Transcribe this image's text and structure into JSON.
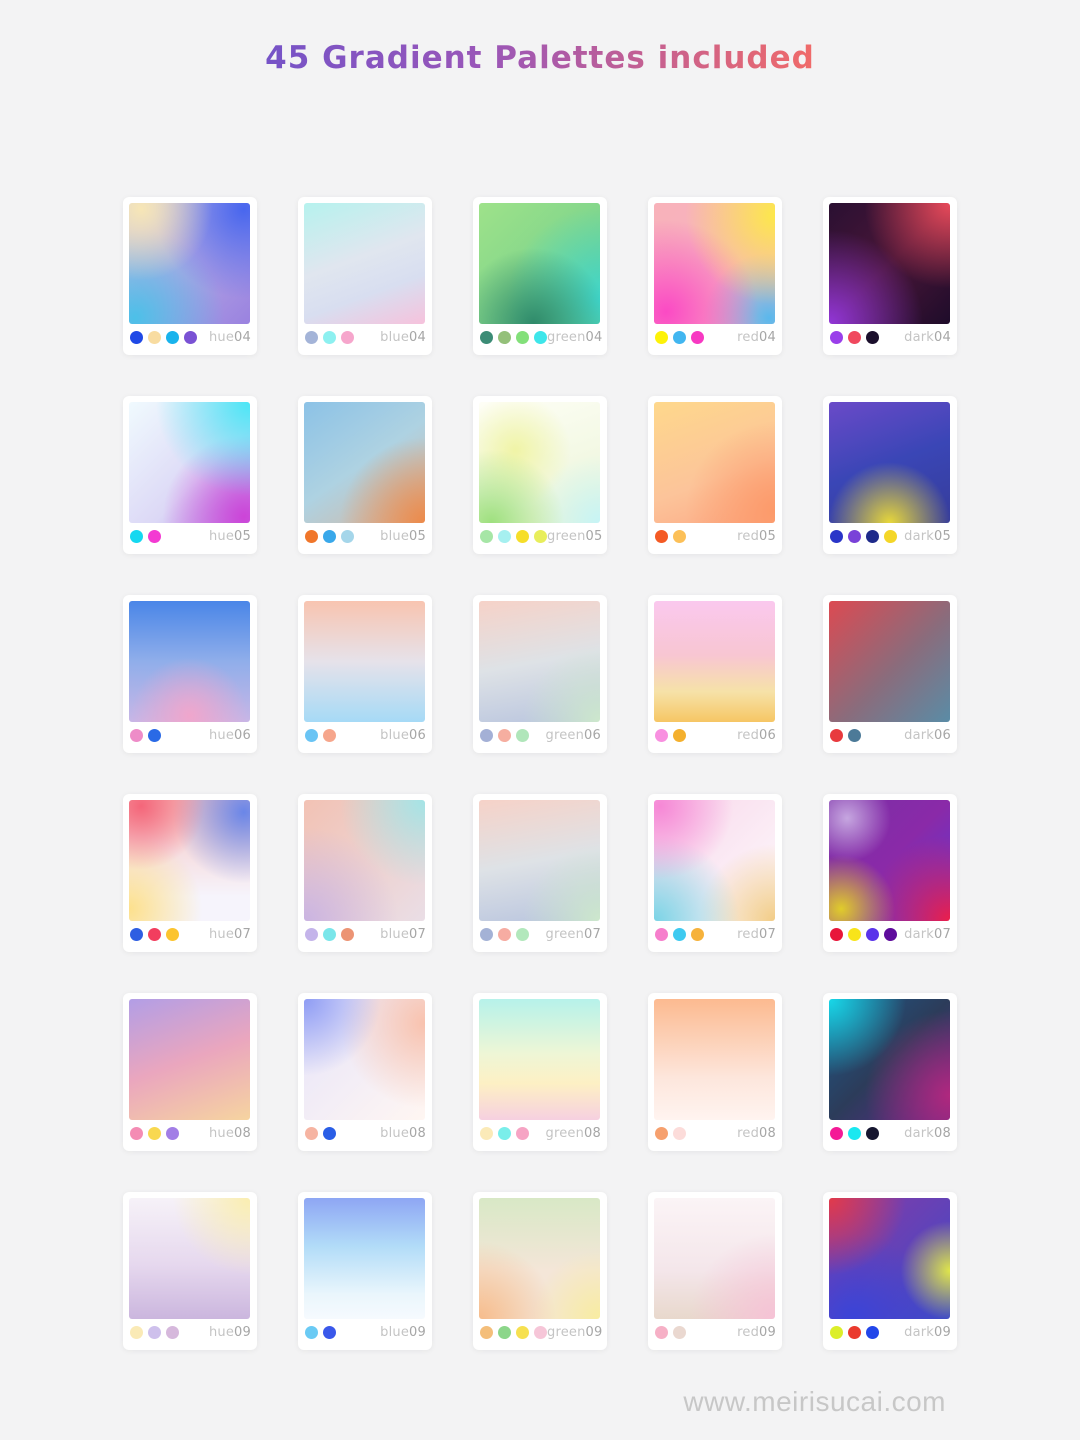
{
  "title": "45 Gradient Palettes included",
  "watermark": "www.meirisucai.com",
  "palettes": [
    {
      "name": "hue",
      "num": "04",
      "colors": [
        "#1f49e6",
        "#f8dca1",
        "#19b3ec",
        "#7a52d4"
      ]
    },
    {
      "name": "blue",
      "num": "04",
      "colors": [
        "#a4b4d8",
        "#8df0f0",
        "#f6a6cc"
      ]
    },
    {
      "name": "green",
      "num": "04",
      "colors": [
        "#3c8c76",
        "#94c07a",
        "#83e07a",
        "#3ee6ea"
      ]
    },
    {
      "name": "red",
      "num": "04",
      "colors": [
        "#fdf208",
        "#42b6f0",
        "#f739c2"
      ]
    },
    {
      "name": "dark",
      "num": "04",
      "colors": [
        "#9a3fea",
        "#f0485e",
        "#1b0f2c"
      ]
    },
    {
      "name": "hue",
      "num": "05",
      "colors": [
        "#15d8f0",
        "#f33ad2"
      ]
    },
    {
      "name": "blue",
      "num": "05",
      "colors": [
        "#f0762a",
        "#39a8ea",
        "#a5d6ea"
      ]
    },
    {
      "name": "green",
      "num": "05",
      "colors": [
        "#a6e6a6",
        "#a6f0f0",
        "#f6de2a",
        "#e8ee5c"
      ]
    },
    {
      "name": "red",
      "num": "05",
      "colors": [
        "#f45a24",
        "#fcc058"
      ]
    },
    {
      "name": "dark",
      "num": "05",
      "colors": [
        "#2a35c8",
        "#7a42d8",
        "#1e2a8a",
        "#f4d628"
      ]
    },
    {
      "name": "hue",
      "num": "06",
      "colors": [
        "#ee8cc8",
        "#2a6ae6"
      ]
    },
    {
      "name": "blue",
      "num": "06",
      "colors": [
        "#6ac4f4",
        "#f6a68c"
      ]
    },
    {
      "name": "green",
      "num": "06",
      "colors": [
        "#a4b0d6",
        "#f6aea0",
        "#b0e6ba"
      ]
    },
    {
      "name": "red",
      "num": "06",
      "colors": [
        "#f890e0",
        "#f4b02e"
      ]
    },
    {
      "name": "dark",
      "num": "06",
      "colors": [
        "#e83a3e",
        "#4c7a98"
      ]
    },
    {
      "name": "hue",
      "num": "07",
      "colors": [
        "#2e5ee2",
        "#f23e5e",
        "#fcc42e"
      ]
    },
    {
      "name": "blue",
      "num": "07",
      "colors": [
        "#c4b4ea",
        "#7ae6ea",
        "#ec9474"
      ]
    },
    {
      "name": "green",
      "num": "07",
      "colors": [
        "#a4b2d6",
        "#f6aca2",
        "#b2e8bc"
      ]
    },
    {
      "name": "red",
      "num": "07",
      "colors": [
        "#f67ecc",
        "#3ecaf0",
        "#f6b23c"
      ]
    },
    {
      "name": "dark",
      "num": "07",
      "colors": [
        "#e8163a",
        "#f8e41a",
        "#5a34ea",
        "#5e0c9c"
      ]
    },
    {
      "name": "hue",
      "num": "08",
      "colors": [
        "#f48cb4",
        "#f8d850",
        "#a27ee6"
      ]
    },
    {
      "name": "blue",
      "num": "08",
      "colors": [
        "#f6b4a2",
        "#2a5ee6"
      ]
    },
    {
      "name": "green",
      "num": "08",
      "colors": [
        "#fbeab8",
        "#7aeeea",
        "#f6a4c4"
      ]
    },
    {
      "name": "red",
      "num": "08",
      "colors": [
        "#f6a06e",
        "#fcdcda"
      ]
    },
    {
      "name": "dark",
      "num": "08",
      "colors": [
        "#f41a96",
        "#1ae8f0",
        "#161630"
      ]
    },
    {
      "name": "hue",
      "num": "09",
      "colors": [
        "#faeab6",
        "#cec0ec",
        "#d6b8dc"
      ]
    },
    {
      "name": "blue",
      "num": "09",
      "colors": [
        "#6acaf4",
        "#3a58ea"
      ]
    },
    {
      "name": "green",
      "num": "09",
      "colors": [
        "#f4be7a",
        "#8cd68a",
        "#f6e050",
        "#f6c6d8"
      ]
    },
    {
      "name": "red",
      "num": "09",
      "colors": [
        "#f6b0c6",
        "#ead8d0"
      ]
    },
    {
      "name": "dark",
      "num": "09",
      "colors": [
        "#dcee2a",
        "#ea3a2e",
        "#2246ea"
      ]
    }
  ]
}
